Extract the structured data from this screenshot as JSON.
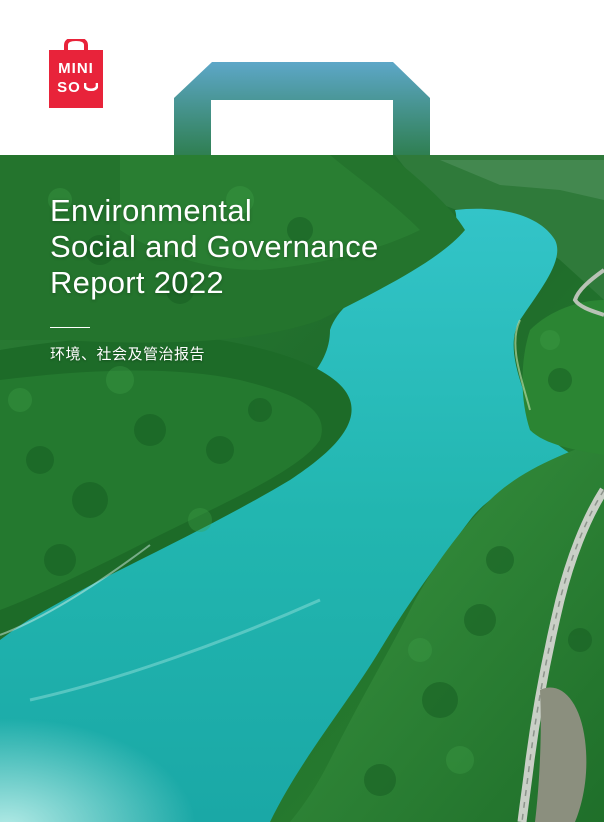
{
  "brand": {
    "line1": "MINI",
    "line2": "SO",
    "color": "#e8233a"
  },
  "cover": {
    "title_line1": "Environmental",
    "title_line2": "Social and Governance",
    "title_line3": "Report 2022",
    "subtitle": "环境、社会及管治报告"
  },
  "colors": {
    "water": "#2bbcb4",
    "forest": "#1f7a2c",
    "sky_bag": "#3aa3e0"
  }
}
